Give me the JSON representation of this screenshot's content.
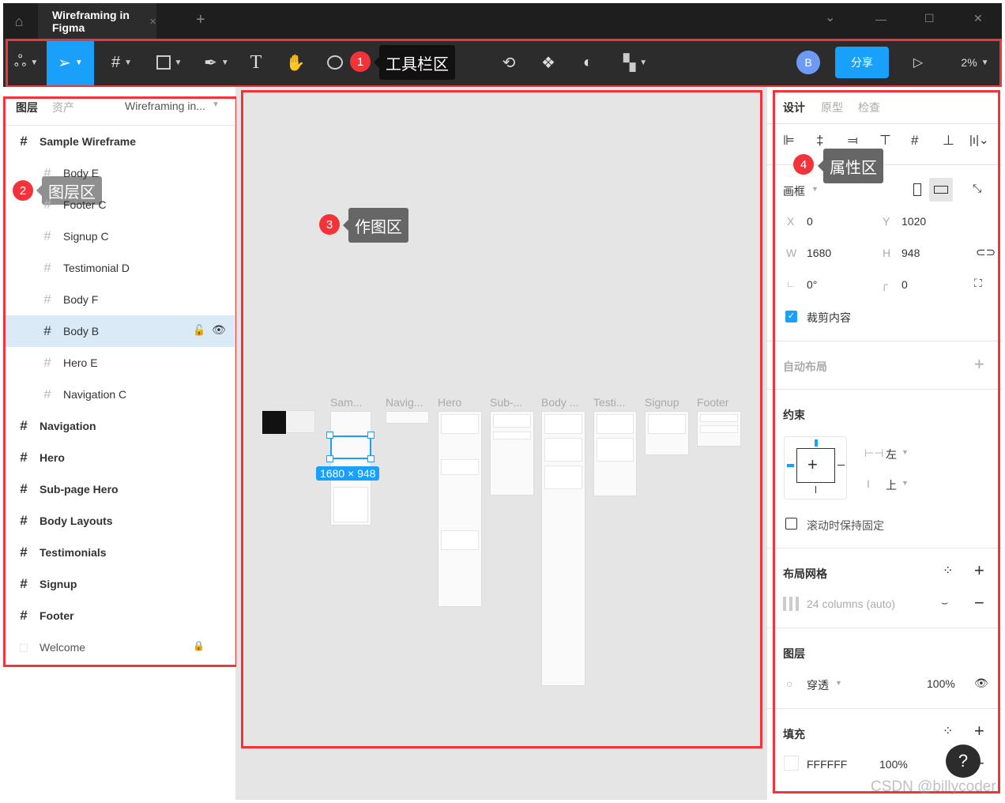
{
  "window": {
    "tab_title": "Wireframing in Figma",
    "close_tab": "×",
    "new_tab": "+",
    "minimize": "—",
    "maximize": "☐",
    "close": "✕",
    "dropdown": "⌄"
  },
  "toolbar": {
    "avatar": "B",
    "share": "分享",
    "zoom": "2%",
    "accent": "#18a0fb"
  },
  "annotations": [
    {
      "num": "1",
      "label": "工具栏区"
    },
    {
      "num": "2",
      "label": "图层区"
    },
    {
      "num": "3",
      "label": "作图区"
    },
    {
      "num": "4",
      "label": "属性区"
    }
  ],
  "left": {
    "tabs": [
      "图层",
      "资产"
    ],
    "page": "Wireframing in...",
    "layers": [
      {
        "name": "Sample Wireframe"
      },
      {
        "name": "Body E"
      },
      {
        "name": "Footer C"
      },
      {
        "name": "Signup C"
      },
      {
        "name": "Testimonial D"
      },
      {
        "name": "Body F"
      },
      {
        "name": "Body B"
      },
      {
        "name": "Hero E"
      },
      {
        "name": "Navigation C"
      },
      {
        "name": "Navigation"
      },
      {
        "name": "Hero"
      },
      {
        "name": "Sub-page Hero"
      },
      {
        "name": "Body Layouts"
      },
      {
        "name": "Testimonials"
      },
      {
        "name": "Signup"
      },
      {
        "name": "Footer"
      },
      {
        "name": "Welcome"
      }
    ]
  },
  "canvas": {
    "frames": [
      "Sam...",
      "Navig...",
      "Hero",
      "Sub-...",
      "Body ...",
      "Testi...",
      "Signup",
      "Footer"
    ],
    "selection_size": "1680 × 948"
  },
  "right": {
    "tabs": [
      "设计",
      "原型",
      "检查"
    ],
    "frame_label": "画框",
    "x_label": "X",
    "x": "0",
    "y_label": "Y",
    "y": "1020",
    "w_label": "W",
    "w": "1680",
    "h_label": "H",
    "h": "948",
    "rotation": "0°",
    "radius": "0",
    "clip_content": "裁剪内容",
    "clip_checked": true,
    "auto_layout": "自动布局",
    "constraints": "约束",
    "h_constraint": "左",
    "v_constraint": "上",
    "fix_scroll": "滚动时保持固定",
    "layout_grid": "布局网格",
    "grid_value": "24 columns (auto)",
    "layer": "图层",
    "blend": "穿透",
    "opacity": "100%",
    "fill": "填充",
    "fill_hex": "FFFFFF",
    "fill_opacity": "100%",
    "help": "?"
  },
  "watermark": "CSDN @billycoder"
}
